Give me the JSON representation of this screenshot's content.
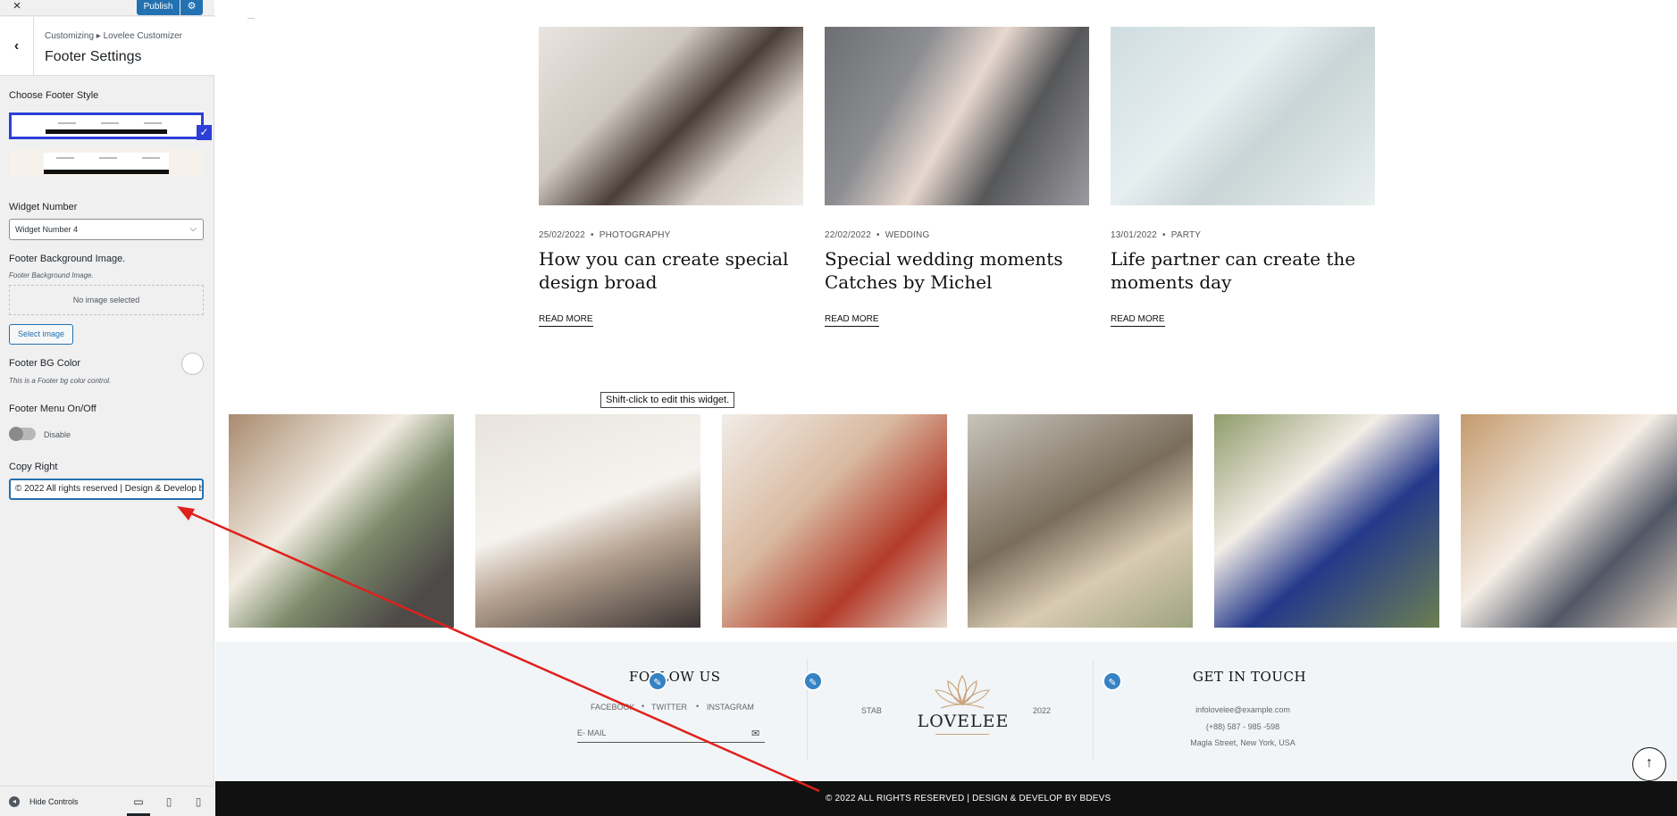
{
  "sidebar": {
    "close_icon": "×",
    "publish_label": "Publish",
    "settings_icon": "⚙",
    "back_icon": "‹",
    "breadcrumb": "Customizing  ▸  Lovelee Customizer",
    "section_title": "Footer Settings",
    "controls": {
      "footer_style_label": "Choose Footer Style",
      "widget_number_label": "Widget Number",
      "widget_number_value": "Widget Number 4",
      "widget_number_arrow": "⌵",
      "bg_image_label": "Footer Background Image.",
      "bg_image_desc": "Footer Background Image.",
      "no_image_text": "No image selected",
      "select_image_label": "Select image",
      "bg_color_label": "Footer BG Color",
      "bg_color_desc": "This is a Footer bg color control.",
      "bg_color_value": "#ffffff",
      "menu_toggle_label": "Footer Menu On/Off",
      "menu_toggle_state": "Disable",
      "copyright_label": "Copy Right",
      "copyright_value": "© 2022 All rights reserved | Design & Develop by BDevs"
    },
    "footer": {
      "hide_controls_label": "Hide Controls",
      "hide_controls_icon": "◂",
      "desktop_icon": "▭",
      "tablet_icon": "▯",
      "mobile_icon": "▯"
    }
  },
  "preview": {
    "posts": [
      {
        "date": "25/02/2022",
        "category": "PHOTOGRAPHY",
        "title": "How you can create special design broad",
        "read_more": "READ MORE"
      },
      {
        "date": "22/02/2022",
        "category": "WEDDING",
        "title": "Special wedding moments Catches by Michel",
        "read_more": "READ MORE"
      },
      {
        "date": "13/01/2022",
        "category": "PARTY",
        "title": "Life partner can create the moments day",
        "read_more": "READ MORE"
      }
    ],
    "meta_separator": "•",
    "tooltip": "Shift-click to edit this widget.",
    "footer": {
      "follow_heading": "FOLLOW US",
      "social": [
        "FACEBOOK",
        "TWITTER",
        "INSTAGRAM"
      ],
      "newsletter_placeholder": "E- MAIL",
      "newsletter_icon": "✉",
      "stab_text": "STAB",
      "logo_text": "LOVELEE",
      "year_text": "2022",
      "contact_heading": "GET IN TOUCH",
      "email": "infolovelee@example.com",
      "phone": "(+88) 587 - 985 -598",
      "address": "Magla Street, New York, USA",
      "edit_icon": "✎"
    },
    "bottom_bar": "© 2022 ALL RIGHTS RESERVED  |  DESIGN & DEVELOP BY BDEVS",
    "back_to_top_icon": "↑"
  },
  "colors": {
    "wp_blue": "#2271b1",
    "selection_blue": "#2c3fd8",
    "annotation_red": "#e0201b",
    "footer_bg": "#f1f5f7",
    "bottom_bar_bg": "#111111"
  }
}
